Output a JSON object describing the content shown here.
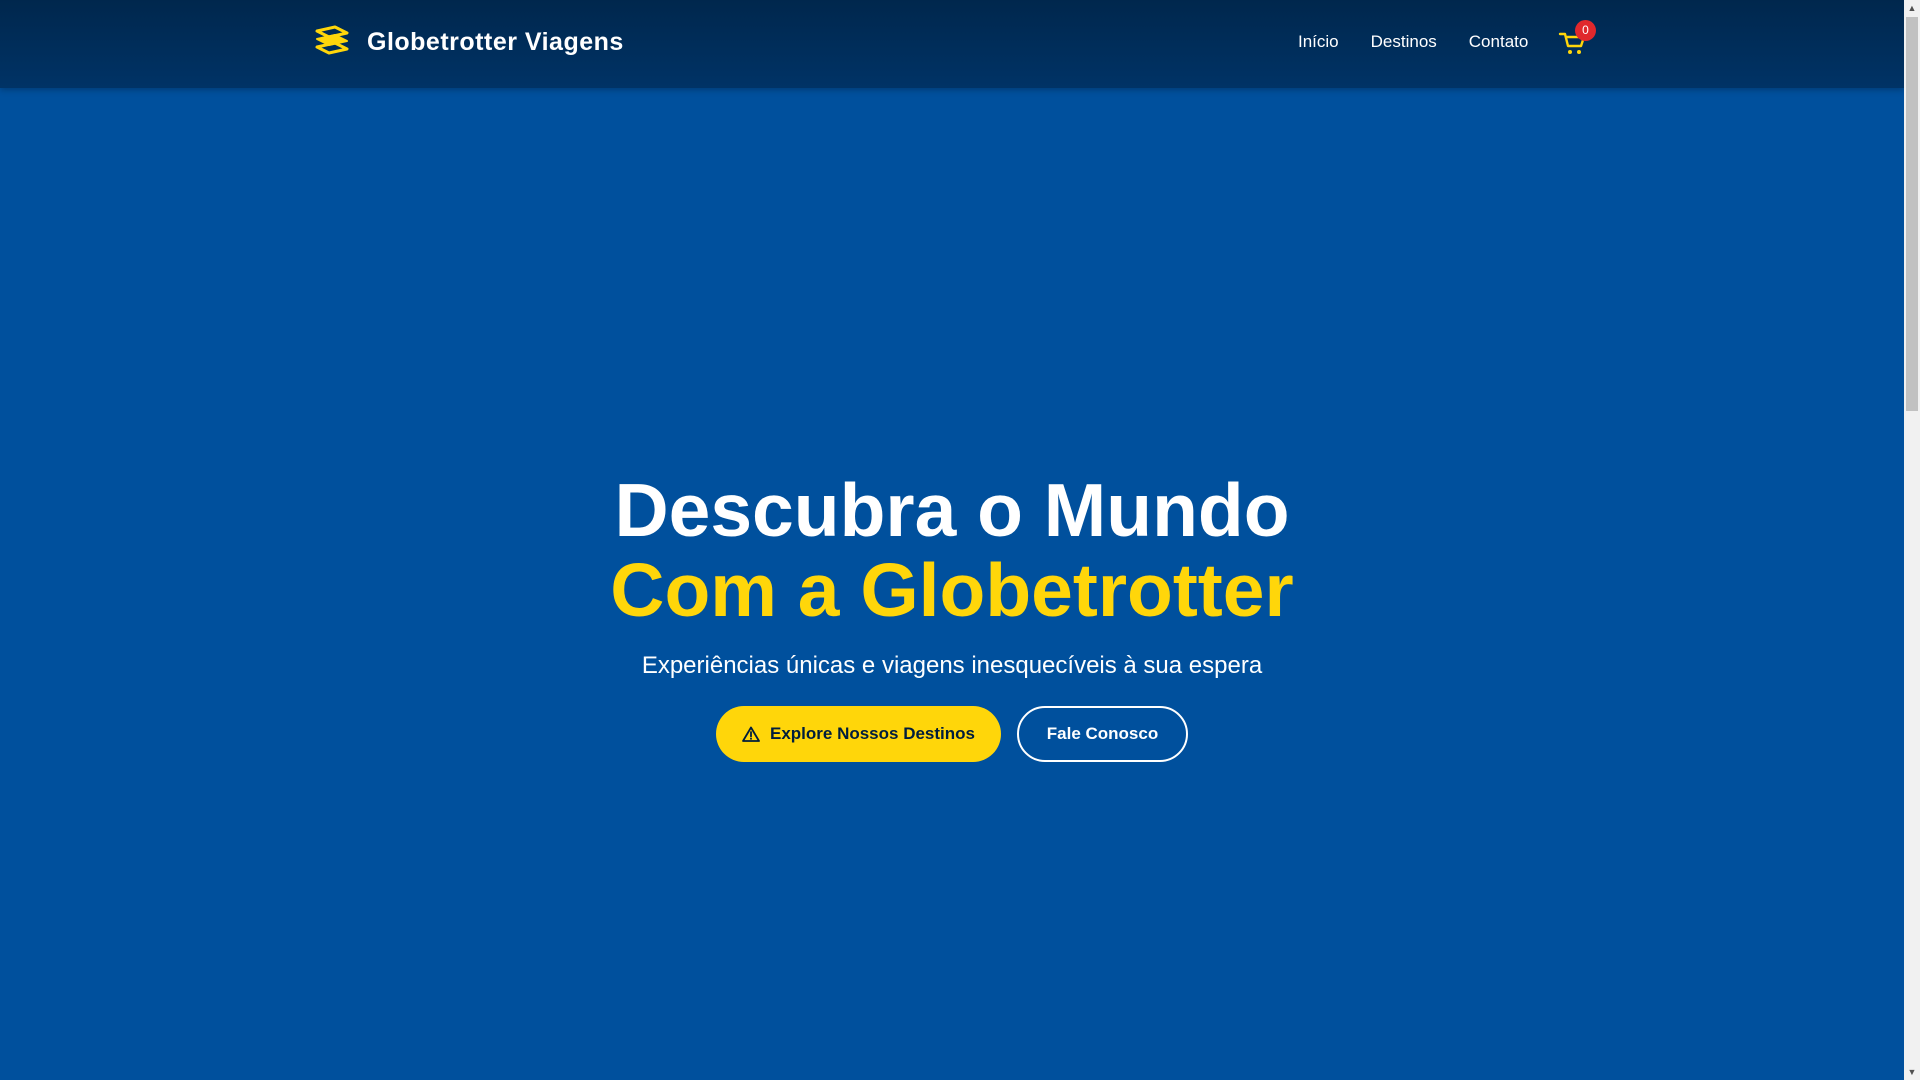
{
  "brand": {
    "name": "Globetrotter Viagens",
    "logo_icon": "layers-logo-icon",
    "accent_color": "#ffd60a"
  },
  "nav": {
    "items": [
      {
        "label": "Início"
      },
      {
        "label": "Destinos"
      },
      {
        "label": "Contato"
      }
    ]
  },
  "cart": {
    "icon": "cart-icon",
    "count": "0"
  },
  "hero": {
    "title_line1": "Descubra o Mundo",
    "title_line2": "Com a Globetrotter",
    "subtitle": "Experiências únicas e viagens inesquecíveis à sua espera",
    "primary_button": {
      "label": "Explore Nossos Destinos",
      "icon": "warning-triangle-icon"
    },
    "secondary_button": {
      "label": "Fale Conosco"
    },
    "background_color": "#00509d"
  },
  "header": {
    "background_color": "#003366"
  }
}
